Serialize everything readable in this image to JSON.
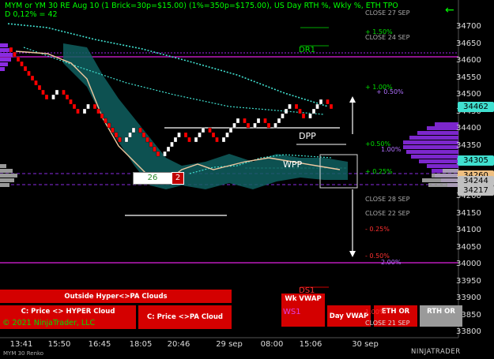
{
  "header": {
    "line1": "MYM or YM 30 RE Aug 10 (1 Brick=30p=$15.00) (1%=350p=$175.00), US Day RTH %, Wkly %, ETH TPO",
    "line2": "D 0,12% = 42"
  },
  "price_axis": [
    "34700",
    "34650",
    "34600",
    "34550",
    "34500",
    "34450",
    "34400",
    "34350",
    "34300",
    "34250",
    "34200",
    "34150",
    "34100",
    "34050",
    "34000",
    "33950",
    "33900",
    "33850",
    "33800"
  ],
  "price_tags": [
    {
      "value": "34462",
      "color": "#40e0d0"
    },
    {
      "value": "34305",
      "color": "#40e0d0"
    },
    {
      "value": "34260",
      "color": "#f0c080"
    },
    {
      "value": "34244",
      "color": "#c0c0c0"
    },
    {
      "value": "34217",
      "color": "#c0c0c0"
    }
  ],
  "time_axis": [
    "13:41",
    "15:50",
    "16:45",
    "18:05",
    "20:46",
    "29 sep",
    "08:00",
    "15:06",
    "30 sep"
  ],
  "levels": {
    "close27": "CLOSE 27 SEP",
    "p150": "+ 1.50%",
    "close24": "CLOSE 24 SEP",
    "dr1": "DR1",
    "p100": "+ 1.00%",
    "p050b": "+ 0.50%",
    "p050": "+0.50%",
    "p100b": "1.00%",
    "dpp": "DPP",
    "wpp": "WPP",
    "p025": "+ 0.25%",
    "close28": "CLOSE 28 SEP",
    "close22": "CLOSE 22 SEP",
    "m025": "- 0.25%",
    "m050": "- 0.50%",
    "m200": "2.00%",
    "ds1": "DS1",
    "ws1": "WS1",
    "close21": "CLOSE 21 SEP",
    "m100": "1.00%"
  },
  "counter": {
    "value": "26",
    "badge": "2"
  },
  "buttons": {
    "outside_hyper": "Outside Hyper<>PA Clouds",
    "price_hyper": "C: Price <> HYPER Cloud",
    "price_pa": "C: Price <>PA Cloud",
    "wk_vwap": "Wk VWAP",
    "day_vwap": "Day VWAP",
    "eth_or": "ETH OR",
    "rth_or": "RTH OR"
  },
  "copyright": "© 2021 NinjaTrader, LLC",
  "footer": {
    "instrument": "MYM 30 Renko",
    "brand": "NINJATRADER"
  },
  "colors": {
    "up": "#ffffff",
    "down": "#ff0000",
    "cloud": "#1a8a8a",
    "magenta": "#e020e0",
    "purple": "#8a2be2",
    "green": "#00ff00"
  }
}
